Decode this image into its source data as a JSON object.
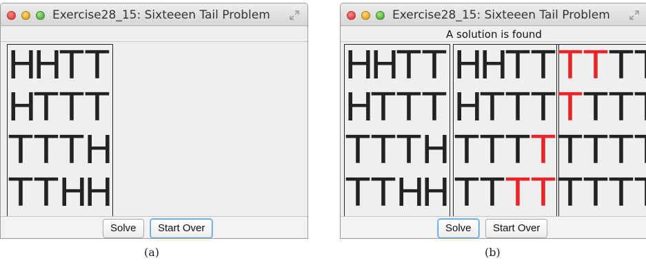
{
  "windows": [
    {
      "title": "Exercise28_15: Sixteeen Tail Problem",
      "status": "",
      "boards": [
        {
          "rows": [
            [
              "H",
              "H",
              "T",
              "T"
            ],
            [
              "H",
              "T",
              "T",
              "T"
            ],
            [
              "T",
              "T",
              "T",
              "H"
            ],
            [
              "T",
              "T",
              "H",
              "H"
            ]
          ]
        }
      ],
      "buttons": {
        "solve": "Solve",
        "start_over": "Start Over"
      },
      "focused_button": "start_over",
      "caption": "(a)"
    },
    {
      "title": "Exercise28_15: Sixteeen Tail Problem",
      "status": "A solution is found",
      "boards": [
        {
          "rows": [
            [
              "H",
              "H",
              "T",
              "T"
            ],
            [
              "H",
              "T",
              "T",
              "T"
            ],
            [
              "T",
              "T",
              "T",
              "H"
            ],
            [
              "T",
              "T",
              "H",
              "H"
            ]
          ]
        },
        {
          "rows": [
            [
              "H",
              "H",
              "T",
              "T"
            ],
            [
              "H",
              "T",
              "T",
              "T"
            ],
            [
              "T",
              "T",
              "T",
              "T"
            ],
            [
              "T",
              "T",
              "T",
              "T"
            ]
          ],
          "flipped": [
            [
              2,
              3
            ],
            [
              3,
              2
            ],
            [
              3,
              3
            ]
          ]
        },
        {
          "rows": [
            [
              "T",
              "T",
              "T",
              "T"
            ],
            [
              "T",
              "T",
              "T",
              "T"
            ],
            [
              "T",
              "T",
              "T",
              "T"
            ],
            [
              "T",
              "T",
              "T",
              "T"
            ]
          ],
          "flipped": [
            [
              0,
              0
            ],
            [
              0,
              1
            ],
            [
              1,
              0
            ]
          ]
        }
      ],
      "buttons": {
        "solve": "Solve",
        "start_over": "Start Over"
      },
      "focused_button": "solve",
      "caption": "(b)"
    }
  ],
  "colors": {
    "flipped_letter": "#e8262a",
    "letter": "#222222",
    "focus_ring": "#4a9fe0"
  },
  "icons": {
    "close": "close-icon",
    "minimize": "minimize-icon",
    "zoom": "zoom-icon",
    "fullscreen": "fullscreen-icon"
  }
}
